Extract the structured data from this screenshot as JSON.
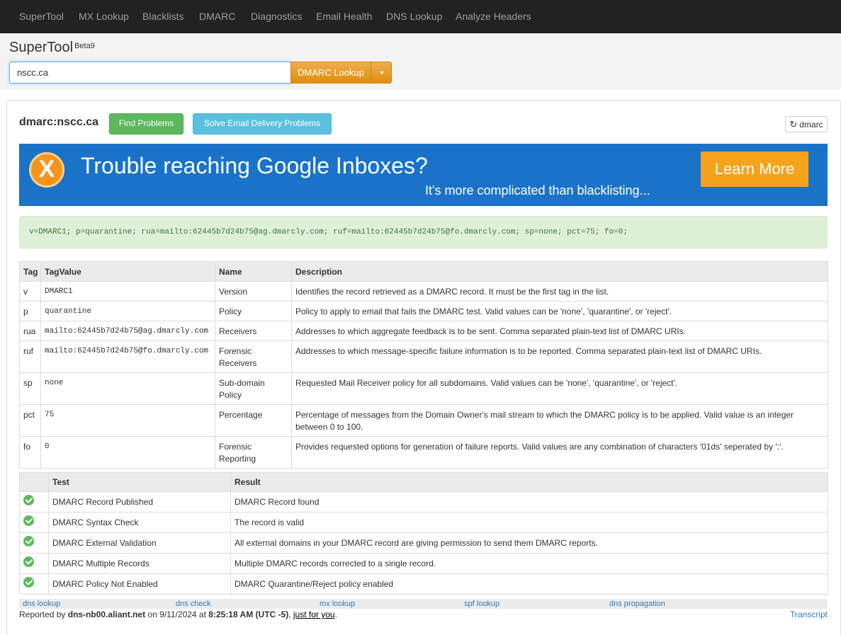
{
  "nav": {
    "items": [
      "SuperTool",
      "MX Lookup",
      "Blacklists",
      "DMARC",
      "Diagnostics",
      "Email Health",
      "DNS Lookup",
      "Analyze Headers"
    ]
  },
  "header": {
    "brand": "SuperTool",
    "beta": "Beta9",
    "search_value": "nscc.ca",
    "lookup_label": "DMARC Lookup"
  },
  "result": {
    "title": "dmarc:nscc.ca",
    "find_problems": "Find Problems",
    "solve_problems": "Solve Email Delivery Problems",
    "refresh_label": "dmarc"
  },
  "banner": {
    "logo_letter": "X",
    "headline": "Trouble reaching Google Inboxes?",
    "subline": "It's more complicated than blacklisting...",
    "cta": "Learn More"
  },
  "record": "v=DMARC1; p=quarantine; rua=mailto:62445b7d24b75@ag.dmarcly.com; ruf=mailto:62445b7d24b75@fo.dmarcly.com; sp=none; pct=75; fo=0;",
  "tag_table": {
    "headers": [
      "Tag",
      "TagValue",
      "Name",
      "Description"
    ],
    "rows": [
      {
        "tag": "v",
        "value": "DMARC1",
        "name": "Version",
        "desc": "Identifies the record retrieved as a DMARC record. It must be the first tag in the list."
      },
      {
        "tag": "p",
        "value": "quarantine",
        "name": "Policy",
        "desc": "Policy to apply to email that fails the DMARC test. Valid values can be 'none', 'quarantine', or 'reject'."
      },
      {
        "tag": "rua",
        "value": "mailto:62445b7d24b75@ag.dmarcly.com",
        "name": "Receivers",
        "desc": "Addresses to which aggregate feedback is to be sent. Comma separated plain-text list of DMARC URIs."
      },
      {
        "tag": "ruf",
        "value": "mailto:62445b7d24b75@fo.dmarcly.com",
        "name": "Forensic Receivers",
        "desc": "Addresses to which message-specific failure information is to be reported. Comma separated plain-text list of DMARC URIs."
      },
      {
        "tag": "sp",
        "value": "none",
        "name": "Sub-domain Policy",
        "desc": "Requested Mail Receiver policy for all subdomains. Valid values can be 'none', 'quarantine', or 'reject'."
      },
      {
        "tag": "pct",
        "value": "75",
        "name": "Percentage",
        "desc": "Percentage of messages from the Domain Owner's mail stream to which the DMARC policy is to be applied. Valid value is an integer between 0 to 100."
      },
      {
        "tag": "fo",
        "value": "0",
        "name": "Forensic Reporting",
        "desc": "Provides requested options for generation of failure reports. Valid values are any combination of characters '01ds' seperated by ':'."
      }
    ]
  },
  "test_table": {
    "headers": [
      "",
      "Test",
      "Result"
    ],
    "rows": [
      {
        "status": "pass",
        "test": "DMARC Record Published",
        "result": "DMARC Record found"
      },
      {
        "status": "pass",
        "test": "DMARC Syntax Check",
        "result": "The record is valid"
      },
      {
        "status": "pass",
        "test": "DMARC External Validation",
        "result": "All external domains in your DMARC record are giving permission to send them DMARC reports."
      },
      {
        "status": "pass",
        "test": "DMARC Multiple Records",
        "result": "Multiple DMARC records corrected to a single record."
      },
      {
        "status": "pass",
        "test": "DMARC Policy Not Enabled",
        "result": "DMARC Quarantine/Reject policy enabled"
      }
    ]
  },
  "footer": {
    "links": [
      "dns lookup",
      "dns check",
      "mx lookup",
      "spf lookup",
      "dns propagation"
    ],
    "reported_by": "Reported by",
    "server": "dns-nb00.aliant.net",
    "on": "on 9/11/2024 at",
    "time": "8:25:18 AM (UTC -5)",
    "sep": ",",
    "just_for_you": "just for you",
    "end": ".",
    "transcript": "Transcript"
  },
  "colors": {
    "navbar": "#222222",
    "orange": "#f0ad4e",
    "green": "#5cb85c",
    "info": "#5bc0de",
    "banner_blue": "#1a73c8"
  }
}
